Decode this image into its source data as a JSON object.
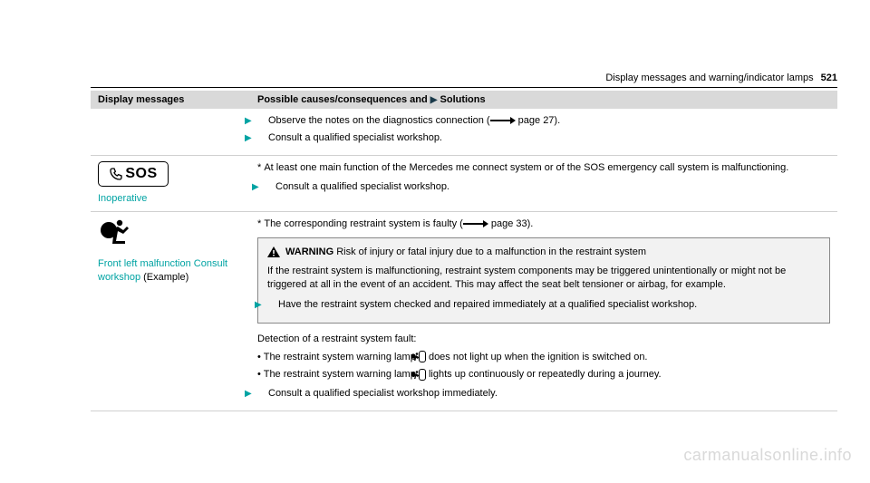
{
  "header": {
    "section_title": "Display messages and warning/indicator lamps",
    "page_number": "521"
  },
  "table": {
    "head": {
      "col1": "Display messages",
      "col2_a": "Possible causes/consequences and ",
      "col2_b": " Solutions"
    },
    "row1": {
      "line1_a": "Observe the notes on the diagnostics connection (",
      "line1_b": " page 27).",
      "line2": "Consult a qualified specialist workshop."
    },
    "row2": {
      "sos_label": "SOS",
      "link": "Inoperative",
      "star_line": "At least one main function of the Mercedes me connect system or of the SOS emergency call system is malfunctioning.",
      "action": "Consult a qualified specialist workshop."
    },
    "row3": {
      "link": "Front left malfunction Consult workshop",
      "link_suffix": " (Example)",
      "star_line_a": "The corresponding restraint system is faulty (",
      "star_line_b": " page 33).",
      "warn_title": "WARNING",
      "warn_head": " Risk of injury or fatal injury due to a malfunction in the restraint system",
      "warn_body": "If the restraint system is malfunctioning, restraint system components may be triggered unintentionally or might not be triggered at all in the event of an accident. This may affect the seat belt tensioner or airbag, for example.",
      "warn_action": "Have the restraint system checked and repaired immediately at a qualified specialist workshop.",
      "detect_head": "Detection of a restraint system fault:",
      "bullet1_a": "The restraint system warning lamp ",
      "bullet1_b": " does not light up when the ignition is switched on.",
      "bullet2_a": "The restraint system warning lamp ",
      "bullet2_b": " lights up continuously or repeatedly during a journey.",
      "final_action": "Consult a qualified specialist workshop immediately."
    }
  },
  "watermark": "carmanualsonline.info"
}
